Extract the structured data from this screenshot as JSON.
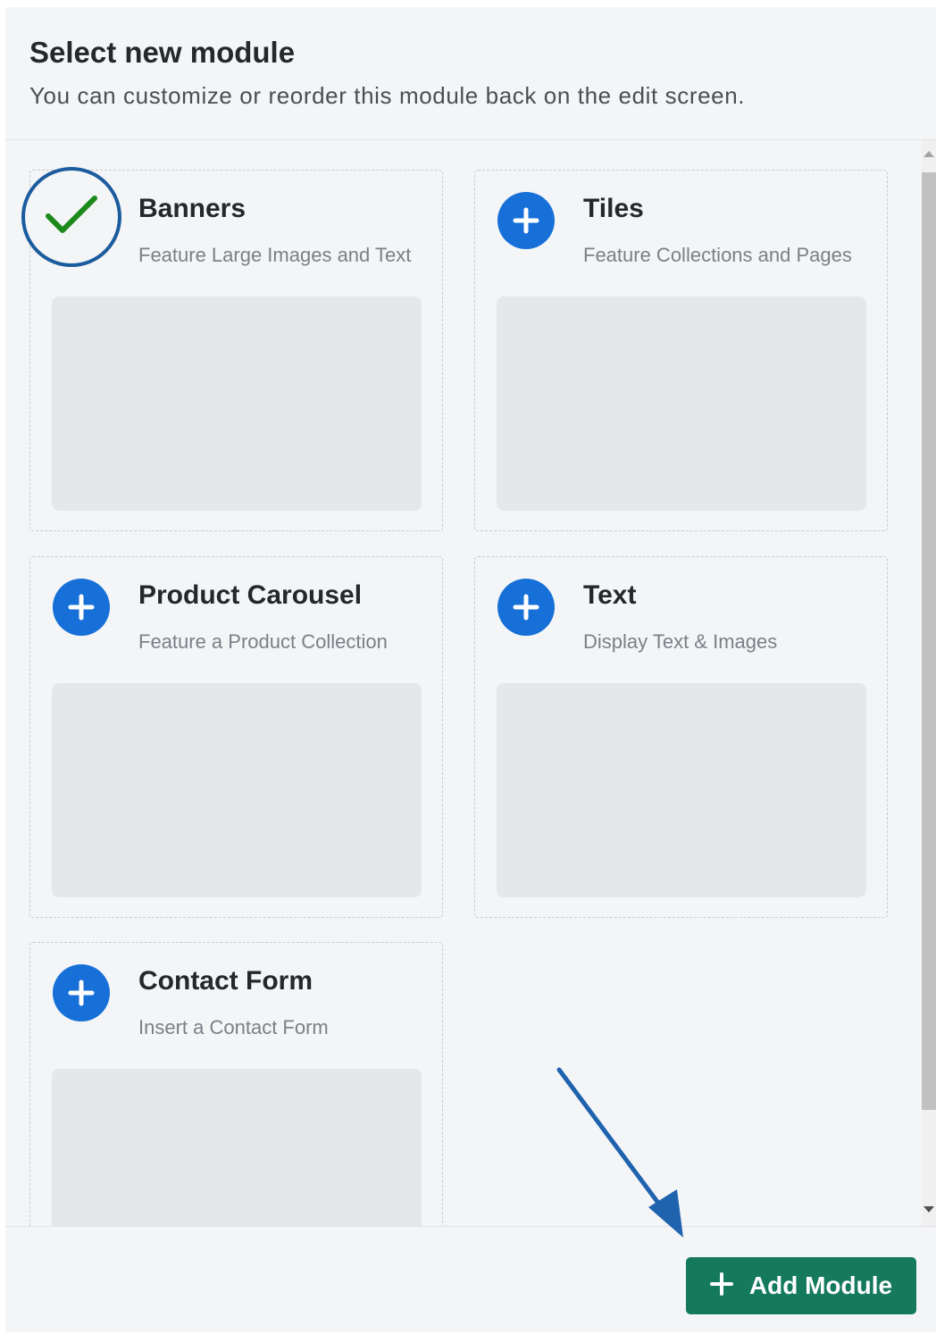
{
  "header": {
    "title": "Select new module",
    "subtitle": "You can customize or reorder this module back on the edit screen."
  },
  "modules": [
    {
      "title": "Banners",
      "description": "Feature Large Images and Text",
      "selected": true,
      "icon": "check-icon"
    },
    {
      "title": "Tiles",
      "description": "Feature Collections and Pages",
      "selected": false,
      "icon": "plus-icon"
    },
    {
      "title": "Product Carousel",
      "description": "Feature a Product Collection",
      "selected": false,
      "icon": "plus-icon"
    },
    {
      "title": "Text",
      "description": "Display Text & Images",
      "selected": false,
      "icon": "plus-icon"
    },
    {
      "title": "Contact Form",
      "description": "Insert a Contact Form",
      "selected": false,
      "icon": "plus-icon"
    }
  ],
  "footer": {
    "add_button_label": "Add Module",
    "add_button_icon": "plus-icon"
  },
  "colors": {
    "primary_blue": "#1670d8",
    "selected_ring": "#1c5c9e",
    "check_green": "#1a8a1a",
    "add_button_green": "#157a5c",
    "annotation_arrow": "#1f63ae"
  }
}
